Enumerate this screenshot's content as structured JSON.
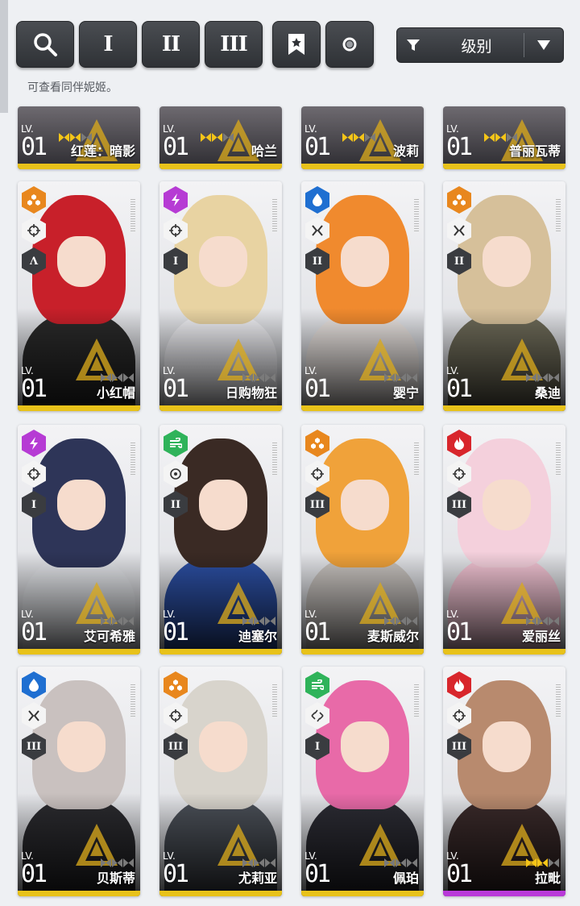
{
  "toolbar": {
    "buttons": [
      {
        "name": "search-button",
        "icon": "search-icon"
      },
      {
        "name": "filter-class-1-button",
        "label": "I"
      },
      {
        "name": "filter-class-2-button",
        "label": "II"
      },
      {
        "name": "filter-class-3-button",
        "label": "III"
      },
      {
        "name": "favorite-filter-button",
        "icon": "bookmark-star-icon"
      },
      {
        "name": "toggle-button",
        "icon": "circle-icon"
      }
    ],
    "sort_label": "级别",
    "hint": "可查看同伴妮姬。"
  },
  "level_prefix": "LV.",
  "partial_cards": [
    {
      "name": "红莲：暗影",
      "level": "01",
      "rarity": "SSR"
    },
    {
      "name": "哈兰",
      "level": "01",
      "rarity": "SSR"
    },
    {
      "name": "波莉",
      "level": "01",
      "rarity": "SSR"
    },
    {
      "name": "普丽瓦蒂",
      "level": "01",
      "rarity": "SSR"
    }
  ],
  "cards": [
    {
      "name": "小红帽",
      "level": "01",
      "element": "iron",
      "element_color": "#e8871e",
      "burst": "Λ",
      "weapon": "sniper-icon",
      "hair": "#c8202a",
      "body": "#2a2a2a"
    },
    {
      "name": "日购物狂",
      "level": "01",
      "element": "electric",
      "element_color": "#b63bd4",
      "burst": "I",
      "weapon": "crosshair-icon",
      "hair": "#e8d3a2",
      "body": "#f0f0f4"
    },
    {
      "name": "婴宁",
      "level": "01",
      "element": "water",
      "element_color": "#1f6fd1",
      "burst": "II",
      "weapon": "dual-icon",
      "hair": "#f08a2e",
      "body": "#e9e3e0"
    },
    {
      "name": "桑迪",
      "level": "01",
      "element": "iron",
      "element_color": "#e8871e",
      "burst": "II",
      "weapon": "dual-icon",
      "hair": "#d6c09a",
      "body": "#6d6a58"
    },
    {
      "name": "艾可希雅",
      "level": "01",
      "element": "electric",
      "element_color": "#b63bd4",
      "burst": "I",
      "weapon": "crosshair-icon",
      "hair": "#2e3558",
      "body": "#e4e6ea"
    },
    {
      "name": "迪塞尔",
      "level": "01",
      "element": "wind",
      "element_color": "#2fb35a",
      "burst": "II",
      "weapon": "rifle-icon",
      "hair": "#3a2a24",
      "body": "#2c4fa3"
    },
    {
      "name": "麦斯威尔",
      "level": "01",
      "element": "iron",
      "element_color": "#e8871e",
      "burst": "III",
      "weapon": "crosshair-icon",
      "hair": "#f0a23a",
      "body": "#c9c4c0"
    },
    {
      "name": "爱丽丝",
      "level": "01",
      "element": "fire",
      "element_color": "#d8262c",
      "burst": "III",
      "weapon": "crosshair-icon",
      "hair": "#f4d0dc",
      "body": "#f3c4d4"
    },
    {
      "name": "贝斯蒂",
      "level": "01",
      "element": "water",
      "element_color": "#1f6fd1",
      "burst": "III",
      "weapon": "dual-icon",
      "hair": "#c9c1bf",
      "body": "#2b2b2f"
    },
    {
      "name": "尤莉亚",
      "level": "01",
      "element": "iron",
      "element_color": "#e8871e",
      "burst": "III",
      "weapon": "crosshair-icon",
      "hair": "#d8d4cc",
      "body": "#4b5058"
    },
    {
      "name": "佩珀",
      "level": "01",
      "element": "wind",
      "element_color": "#2fb35a",
      "burst": "I",
      "weapon": "target-icon",
      "hair": "#e86aa8",
      "body": "#2c2c34"
    },
    {
      "name": "拉毗",
      "level": "01",
      "element": "fire",
      "element_color": "#d8262c",
      "burst": "III",
      "weapon": "crosshair-icon",
      "hair": "#b88a6e",
      "body": "#3a2a2a",
      "bar_color": "#b93ad9",
      "rarity": "SR"
    }
  ]
}
